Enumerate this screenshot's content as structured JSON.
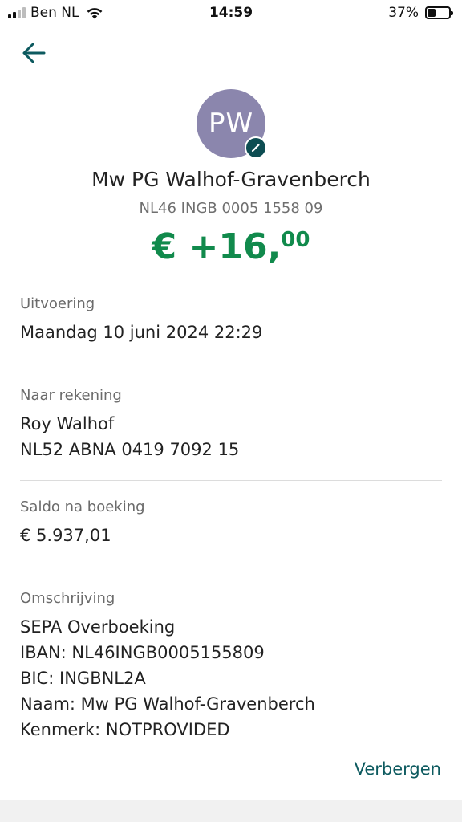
{
  "status_bar": {
    "carrier": "Ben NL",
    "time": "14:59",
    "battery_text": "37%",
    "battery_level": 0.37
  },
  "header": {
    "back_icon": "arrow-left-icon"
  },
  "contact": {
    "initials": "PW",
    "name": "Mw PG Walhof-Gravenberch",
    "iban": "NL46 INGB 0005 1558 09",
    "amount_main": "€ +16,",
    "amount_cents": "00",
    "amount_color": "#118a4c",
    "avatar_color": "#8b86ad",
    "edit_icon": "pencil-icon"
  },
  "sections": {
    "execution": {
      "label": "Uitvoering",
      "value": "Maandag 10 juni 2024 22:29"
    },
    "to_account": {
      "label": "Naar rekening",
      "name": "Roy Walhof",
      "iban": "NL52 ABNA 0419 7092 15"
    },
    "balance": {
      "label": "Saldo na boeking",
      "value": "€ 5.937,01"
    },
    "description": {
      "label": "Omschrijving",
      "lines": [
        "SEPA Overboeking",
        "IBAN: NL46INGB0005155809",
        "BIC: INGBNL2A",
        "Naam: Mw PG Walhof-Gravenberch",
        "Kenmerk: NOTPROVIDED"
      ]
    }
  },
  "actions": {
    "hide_label": "Verbergen",
    "accent_color": "#0d5a5f"
  }
}
